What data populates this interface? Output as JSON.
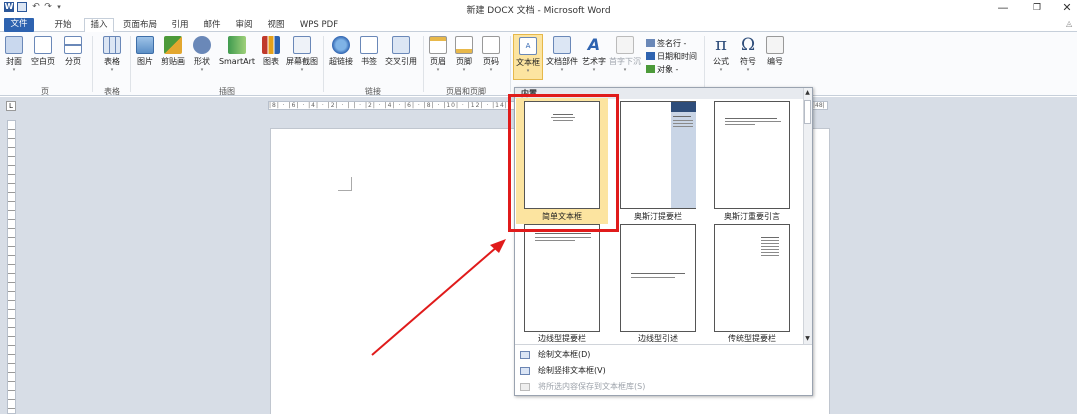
{
  "window": {
    "title": "新建 DOCX 文档 - Microsoft Word",
    "min_icon": "—",
    "max_icon": "❐",
    "close_icon": "✕",
    "app_icon_letter": "W"
  },
  "tabs": [
    {
      "label": "文件"
    },
    {
      "label": "开始"
    },
    {
      "label": "插入"
    },
    {
      "label": "页面布局"
    },
    {
      "label": "引用"
    },
    {
      "label": "邮件"
    },
    {
      "label": "审阅"
    },
    {
      "label": "视图"
    },
    {
      "label": "WPS PDF"
    }
  ],
  "ribbon": {
    "pages": {
      "group": "页",
      "cover": "封面",
      "blank": "空白页",
      "break": "分页"
    },
    "tables": {
      "group": "表格",
      "table": "表格"
    },
    "illustrations": {
      "group": "插图",
      "picture": "图片",
      "clipart": "剪贴画",
      "shapes": "形状",
      "smartart": "SmartArt",
      "chart": "图表",
      "screenshot": "屏幕截图"
    },
    "links": {
      "group": "链接",
      "hyperlink": "超链接",
      "bookmark": "书签",
      "crossref": "交叉引用"
    },
    "header_footer": {
      "group": "页眉和页脚",
      "header": "页眉",
      "footer": "页脚",
      "page_number": "页码"
    },
    "text": {
      "textbox": "文本框",
      "quickparts": "文档部件",
      "wordart": "艺术字",
      "dropcap": "首字下沉",
      "signature": "签名行 -",
      "datetime": "日期和时间",
      "object": "对象 -"
    },
    "symbols": {
      "equation": "公式",
      "symbol": "符号",
      "number": "编号"
    }
  },
  "ruler_text": "|8| · |6| · |4| · |2| · | | · |2| · |4| · |6| · |8| · |10| · |12| · |14|",
  "ruler_right": "|48|",
  "gallery": {
    "header": "内置",
    "tiles": [
      {
        "label": "简单文本框",
        "selected": true
      },
      {
        "label": "奥斯汀提要栏",
        "selected": false
      },
      {
        "label": "奥斯汀重要引言",
        "selected": false
      },
      {
        "label": "边线型提要栏",
        "selected": false
      },
      {
        "label": "边线型引述",
        "selected": false
      },
      {
        "label": "传统型提要栏",
        "selected": false
      }
    ],
    "menu": [
      {
        "label": "绘制文本框(D)",
        "enabled": true
      },
      {
        "label": "绘制竖排文本框(V)",
        "enabled": true
      },
      {
        "label": "将所选内容保存到文本框库(S)",
        "enabled": false
      }
    ]
  },
  "colors": {
    "accent": "#2e63b0",
    "highlight": "#e01b1b",
    "selected_tile": "#fce4a0"
  }
}
